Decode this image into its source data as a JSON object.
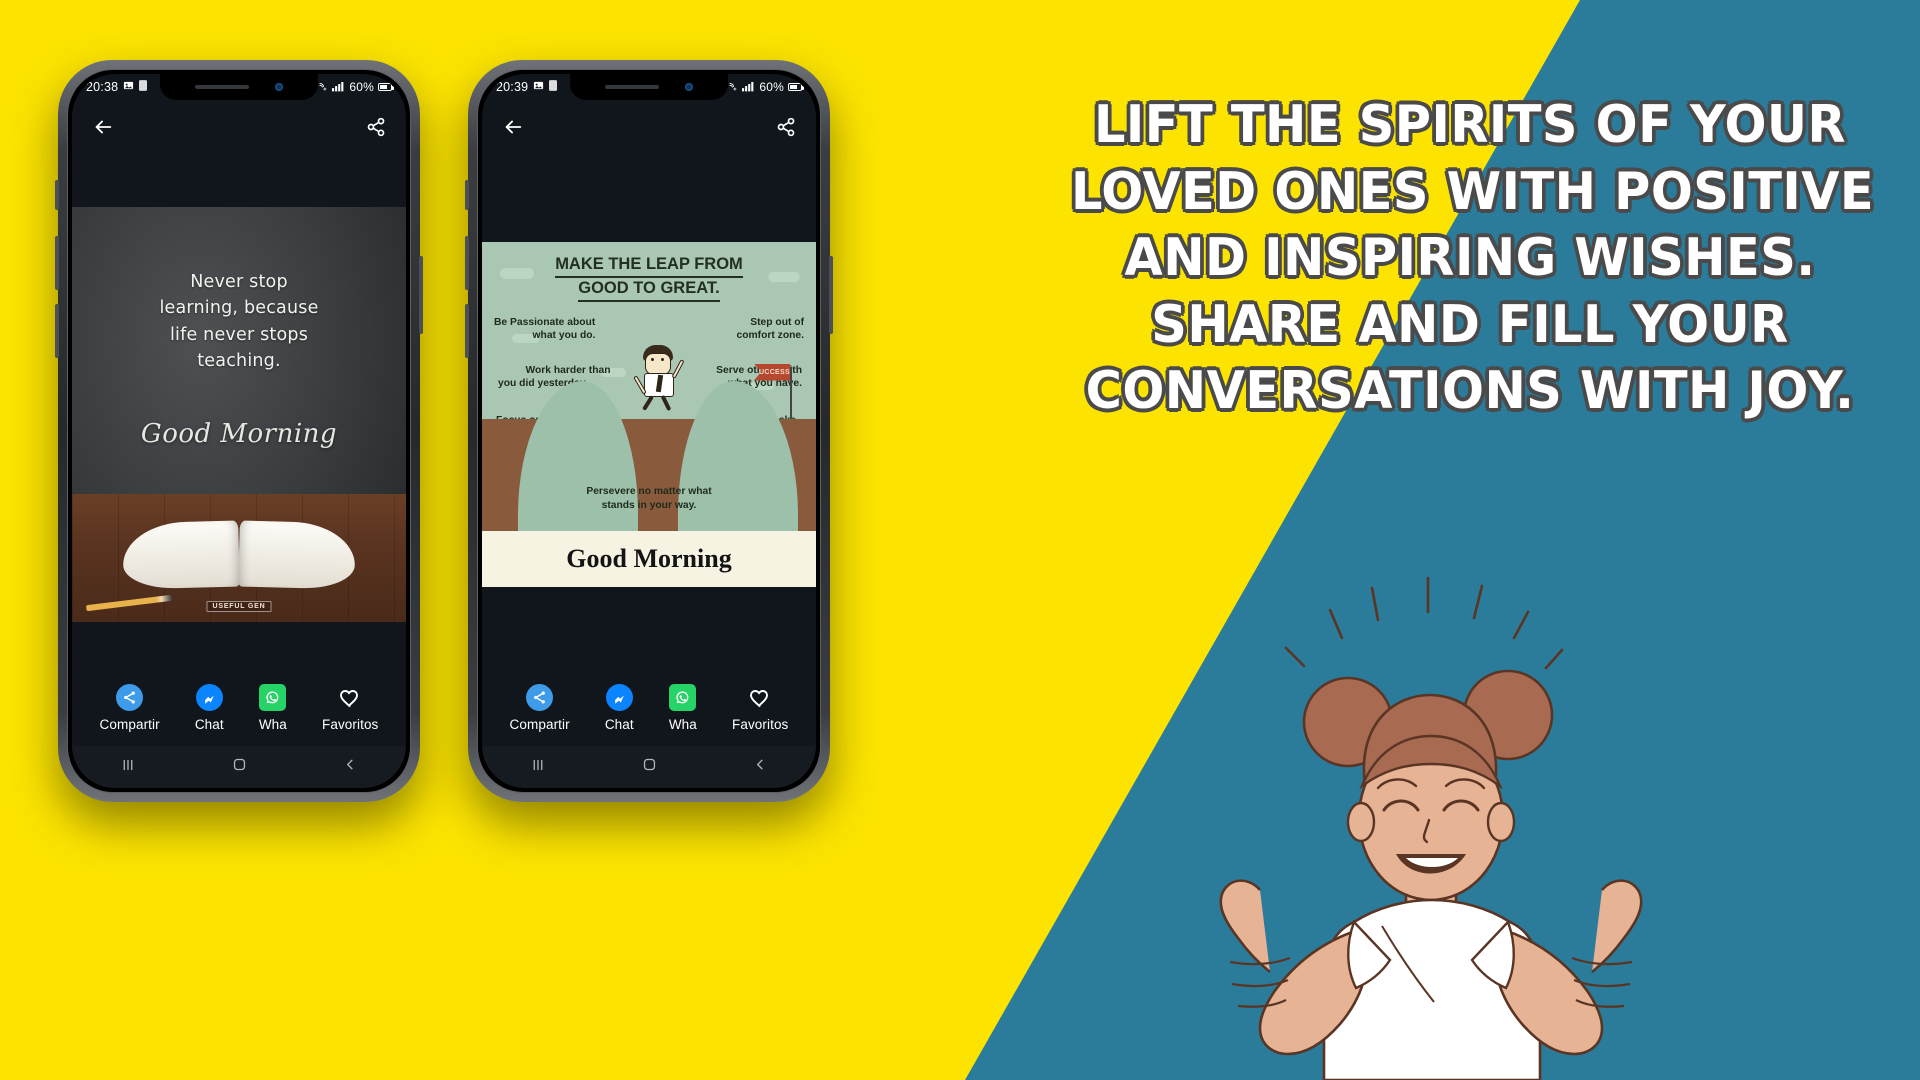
{
  "palette": {
    "yellow": "#FCE400",
    "blue": "#2B7B9B",
    "whatsapp_green": "#25D366",
    "messenger_blue": "#0A84FF",
    "share_blue": "#3D9BE9",
    "board_gray": "#3B3E40",
    "desk_brown": "#5A3420",
    "leap_mint": "#A8C6B2",
    "leap_cream": "#F7F3E2",
    "headline_outline": "#4A4A4A"
  },
  "headline": {
    "lines": [
      "LIFT THE SPIRITS OF YOUR",
      "LOVED ONES WITH POSITIVE",
      "AND INSPIRING WISHES.",
      "SHARE AND FILL YOUR",
      "CONVERSATIONS WITH JOY."
    ]
  },
  "phone1": {
    "status": {
      "time": "20:38",
      "left_icons": [
        "image-icon",
        "app-icon"
      ],
      "right_icons": [
        "nfc-icon",
        "signal-icon"
      ],
      "battery_text": "60%"
    },
    "topbar": {
      "back": "back-arrow-icon",
      "share": "share-icon"
    },
    "card": {
      "type": "blackboard-quote",
      "quote_lines": [
        "Never stop",
        "learning, because",
        "life never stops",
        "teaching."
      ],
      "greeting": "Good Morning",
      "watermark": "USEFUL GEN"
    },
    "actions": [
      {
        "icon": "share-icon",
        "label": "Compartir"
      },
      {
        "icon": "messenger-icon",
        "label": "Chat"
      },
      {
        "icon": "whatsapp-icon",
        "label": "Wha"
      },
      {
        "icon": "heart-icon",
        "label": "Favoritos"
      }
    ],
    "nav": {
      "recents": "recents-icon",
      "home": "home-icon",
      "back": "back-icon"
    }
  },
  "phone2": {
    "status": {
      "time": "20:39",
      "battery_text": "60%"
    },
    "topbar": {
      "back": "back-arrow-icon",
      "share": "share-icon"
    },
    "card": {
      "type": "leap-infographic",
      "title_line1": "MAKE THE LEAP FROM",
      "title_line2": "GOOD TO GREAT.",
      "tips": [
        {
          "position": "top-left",
          "text": "Be Passionate about\nwhat you do."
        },
        {
          "position": "top-right",
          "text": "Step out of\ncomfort zone."
        },
        {
          "position": "mid-left",
          "text": "Work harder than\nyou did yesterday."
        },
        {
          "position": "mid-right",
          "text": "Serve others with\nwhat you have."
        },
        {
          "position": "low-left",
          "text": "Focus on what you\nwant to achieve."
        },
        {
          "position": "low-right",
          "text": "Always make\ntime to think."
        },
        {
          "position": "bottom-center",
          "text": "Persevere no matter what\nstands in your way."
        }
      ],
      "flag_text": "SUCCESS",
      "footer": "Good Morning"
    },
    "actions": [
      {
        "icon": "share-icon",
        "label": "Compartir"
      },
      {
        "icon": "messenger-icon",
        "label": "Chat"
      },
      {
        "icon": "whatsapp-icon",
        "label": "Wha"
      },
      {
        "icon": "heart-icon",
        "label": "Favoritos"
      }
    ],
    "nav": {
      "recents": "recents-icon",
      "home": "home-icon",
      "back": "back-icon"
    }
  },
  "character": {
    "name": "smiling-woman-thumbs-up",
    "skin": "#E6B394",
    "hair": "#A86B52",
    "shirt": "#FFFFFF",
    "outline": "#5A3524"
  }
}
